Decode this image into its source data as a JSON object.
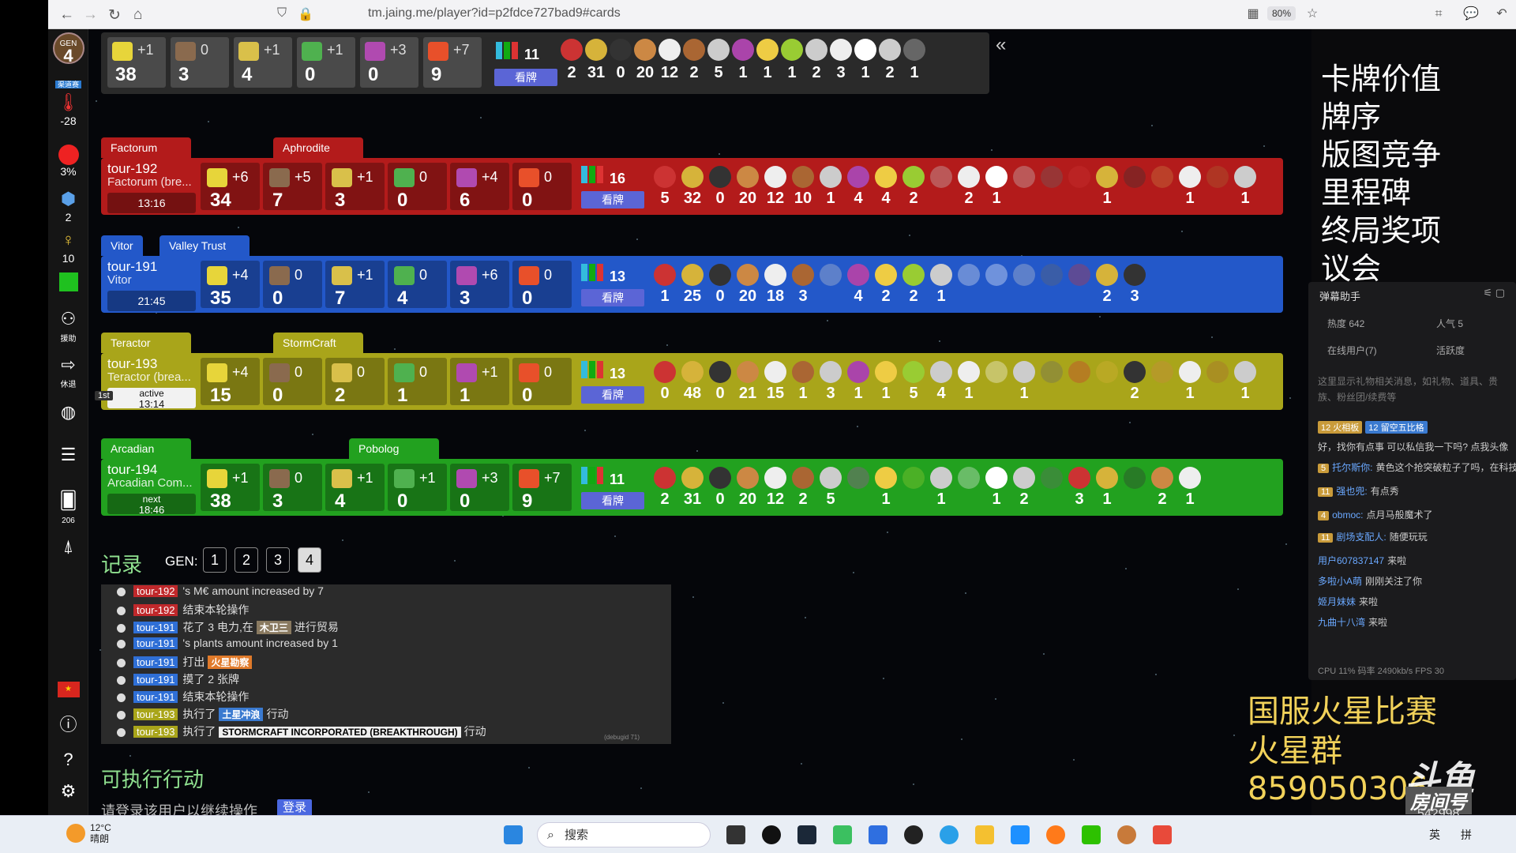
{
  "browser": {
    "url": "tm.jaing.me/player?id=p2fdce727bad9#cards",
    "zoom": "80%"
  },
  "sidebar": {
    "gen_label": "GEN",
    "gen": "4",
    "tag": "渠道赛",
    "temperature": "-28",
    "oxygen": "3%",
    "oceans": "2",
    "venus": "10",
    "help": "援助",
    "exit": "休退",
    "cards": "206"
  },
  "topbar": {
    "resources": [
      {
        "prod": "+1",
        "amt": "38",
        "color": "#e7d53a"
      },
      {
        "prod": "0",
        "amt": "3",
        "color": "#8a6a4e"
      },
      {
        "prod": "+1",
        "amt": "4",
        "color": "#d9c04a"
      },
      {
        "prod": "+1",
        "amt": "0",
        "color": "#4fb14f"
      },
      {
        "prod": "+3",
        "amt": "0",
        "color": "#b04ab0"
      },
      {
        "prod": "+7",
        "amt": "9",
        "color": "#e8502a"
      }
    ],
    "hand": "11",
    "see": "看牌",
    "tags": [
      "2",
      "31",
      "0",
      "20",
      "12",
      "2",
      "5",
      "1",
      "1",
      "1",
      "2",
      "3",
      "1",
      "2",
      "1"
    ]
  },
  "players": [
    {
      "tabs": [
        "Factorum [breakthrough]",
        "Aphrodite [breakthrough]"
      ],
      "name": "tour-192",
      "corp": "Factorum (bre...",
      "time": "13:16",
      "color": "#b31b1b",
      "hand": "16",
      "see": "看牌",
      "resources": [
        {
          "prod": "+6",
          "amt": "34"
        },
        {
          "prod": "+5",
          "amt": "7"
        },
        {
          "prod": "+1",
          "amt": "3"
        },
        {
          "prod": "0",
          "amt": "0"
        },
        {
          "prod": "+4",
          "amt": "6"
        },
        {
          "prod": "0",
          "amt": "0"
        }
      ],
      "tags": [
        "5",
        "32",
        "0",
        "20",
        "12",
        "10",
        "1",
        "4",
        "4",
        "2",
        "",
        "2",
        "1",
        "",
        "",
        "",
        "1",
        "",
        "",
        "1",
        "",
        "1"
      ]
    },
    {
      "tabs": [
        "Vitor",
        "Valley Trust [breakthrough]"
      ],
      "name": "tour-191",
      "corp": "Vitor",
      "time": "21:45",
      "color": "#2358c9",
      "hand": "13",
      "see": "看牌",
      "resources": [
        {
          "prod": "+4",
          "amt": "35"
        },
        {
          "prod": "0",
          "amt": "0"
        },
        {
          "prod": "+1",
          "amt": "7"
        },
        {
          "prod": "0",
          "amt": "4"
        },
        {
          "prod": "+6",
          "amt": "3"
        },
        {
          "prod": "0",
          "amt": "0"
        }
      ],
      "tags": [
        "1",
        "25",
        "0",
        "20",
        "18",
        "3",
        "",
        "4",
        "2",
        "2",
        "1",
        "",
        "",
        "",
        "",
        "",
        "2",
        "3"
      ]
    },
    {
      "tabs": [
        "Teractor [breakthrough]",
        "StormCraft Incorporated [breakthrough]"
      ],
      "name": "tour-193",
      "corp": "Teractor (brea...",
      "time": "13:14",
      "status": "active",
      "rank": "1st",
      "color": "#a9a51a",
      "hand": "13",
      "see": "看牌",
      "resources": [
        {
          "prod": "+4",
          "amt": "15"
        },
        {
          "prod": "0",
          "amt": "0"
        },
        {
          "prod": "0",
          "amt": "2"
        },
        {
          "prod": "0",
          "amt": "1"
        },
        {
          "prod": "+1",
          "amt": "1"
        },
        {
          "prod": "0",
          "amt": "0"
        }
      ],
      "tags": [
        "0",
        "48",
        "0",
        "21",
        "15",
        "1",
        "3",
        "1",
        "1",
        "5",
        "4",
        "1",
        "",
        "1",
        "",
        "",
        "",
        "2",
        "",
        "1",
        "",
        "1"
      ]
    },
    {
      "tabs": [
        "Arcadian Communities [breakthrough]",
        "Pobolog [breakthrough]"
      ],
      "name": "tour-194",
      "corp": "Arcadian Com...",
      "time": "18:46",
      "status": "next",
      "color": "#22a11f",
      "hand": "11",
      "see": "看牌",
      "resources": [
        {
          "prod": "+1",
          "amt": "38"
        },
        {
          "prod": "0",
          "amt": "3"
        },
        {
          "prod": "+1",
          "amt": "4"
        },
        {
          "prod": "+1",
          "amt": "0"
        },
        {
          "prod": "+3",
          "amt": "0"
        },
        {
          "prod": "+7",
          "amt": "9"
        }
      ],
      "tags": [
        "2",
        "31",
        "0",
        "20",
        "12",
        "2",
        "5",
        "",
        "1",
        "",
        "1",
        "",
        "1",
        "2",
        "",
        "3",
        "1",
        "",
        "2",
        "1"
      ]
    }
  ],
  "log": {
    "title": "记录",
    "gen_label": "GEN:",
    "gens": [
      "1",
      "2",
      "3",
      "4"
    ],
    "lines": [
      {
        "player": "tour-192",
        "pc": "#c0282b",
        "text": "'s M€ amount increased by 7"
      },
      {
        "player": "tour-192",
        "pc": "#c0282b",
        "text": "结束本轮操作"
      },
      {
        "player": "tour-191",
        "pc": "#2f6fd6",
        "text": "花了 3 电力,在",
        "card": "木卫三",
        "tail": "进行贸易",
        "cc": "#8a7a60"
      },
      {
        "player": "tour-191",
        "pc": "#2f6fd6",
        "text": "'s plants amount increased by 1"
      },
      {
        "player": "tour-191",
        "pc": "#2f6fd6",
        "text": "打出",
        "card": "火星勘察",
        "cc": "#e07a2a"
      },
      {
        "player": "tour-191",
        "pc": "#2f6fd6",
        "text": "摸了 2 张牌"
      },
      {
        "player": "tour-191",
        "pc": "#2f6fd6",
        "text": "结束本轮操作"
      },
      {
        "player": "tour-193",
        "pc": "#a9a51a",
        "text": "执行了",
        "card": "土星冲浪",
        "tail": "行动",
        "cc": "#3a7ad0"
      },
      {
        "player": "tour-193",
        "pc": "#a9a51a",
        "text": "执行了",
        "card": "STORMCRAFT INCORPORATED (BREAKTHROUGH)",
        "tail": "行动",
        "cc": "#eee"
      }
    ],
    "debug": "(debugid 71)"
  },
  "actions": {
    "title": "可执行行动",
    "login_hint": "请登录该用户以继续操作",
    "login_btn": "登录"
  },
  "overlay": {
    "menu": [
      "卡牌价值",
      "牌序",
      "版图竞争",
      "里程碑",
      "终局奖项",
      "议会"
    ],
    "chat_title": "弹幕助手",
    "heat": "热度 642",
    "popularity": "人气 5",
    "online": "在线用户(7)",
    "activity": "活跃度",
    "sys": "这里显示礼物相关消息，如礼物、道具、贵族、粉丝团/续费等",
    "msgs": [
      {
        "badge": "12 火相板",
        "badge2": "12 留空五比格",
        "text": ""
      },
      {
        "text": "好，找你有点事 可以私信我一下吗? 点我头像"
      },
      {
        "badge": "5",
        "name": "托尔斯你:",
        "text": "黄色这个抢突破粒子了吗，在科技，这样看其实很赚"
      },
      {
        "badge": "11",
        "name": "强也兜:",
        "text": "有点秀"
      },
      {
        "badge": "4",
        "name": "obmoc:",
        "text": "点月马般魔术了"
      },
      {
        "badge": "11",
        "name": "剧场支配人:",
        "text": "随便玩玩"
      },
      {
        "name": "用户607837147",
        "text": "来啦"
      },
      {
        "name": "多啦小A萌",
        "text": "刚刚关注了你"
      },
      {
        "name": "姬月妹妹",
        "text": "来啦"
      },
      {
        "name": "九曲十八湾",
        "text": "来啦"
      }
    ],
    "stats": "CPU 11%    码率 2490kb/s  FPS 30",
    "promo1": "国服火星比赛",
    "promo2": "火星群 859050306",
    "brand": "斗鱼",
    "room": "房间号",
    "room_id": "542998"
  },
  "taskbar": {
    "temp": "12°C",
    "weather": "晴朗",
    "search": "搜索",
    "lang": "英",
    "ime": "拼"
  }
}
